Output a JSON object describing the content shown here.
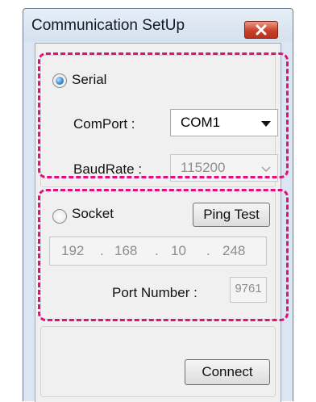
{
  "window": {
    "title": "Communication SetUp"
  },
  "serial": {
    "label": "Serial",
    "selected": true,
    "comport_label": "ComPort :",
    "comport_value": "COM1",
    "baudrate_label": "BaudRate :",
    "baudrate_value": "115200"
  },
  "socket": {
    "label": "Socket",
    "selected": false,
    "ping_label": "Ping Test",
    "ip": [
      "192",
      ".",
      "168",
      ".",
      "10",
      ".",
      "248"
    ],
    "port_label": "Port Number :",
    "port_value": "9761"
  },
  "actions": {
    "connect_label": "Connect"
  },
  "colors": {
    "highlight": "#e0107c",
    "close_button": "#c9412a",
    "title_bar": "#dce6f2"
  },
  "icons": {
    "close": "close-icon",
    "dropdown": "chevron-down-icon"
  }
}
